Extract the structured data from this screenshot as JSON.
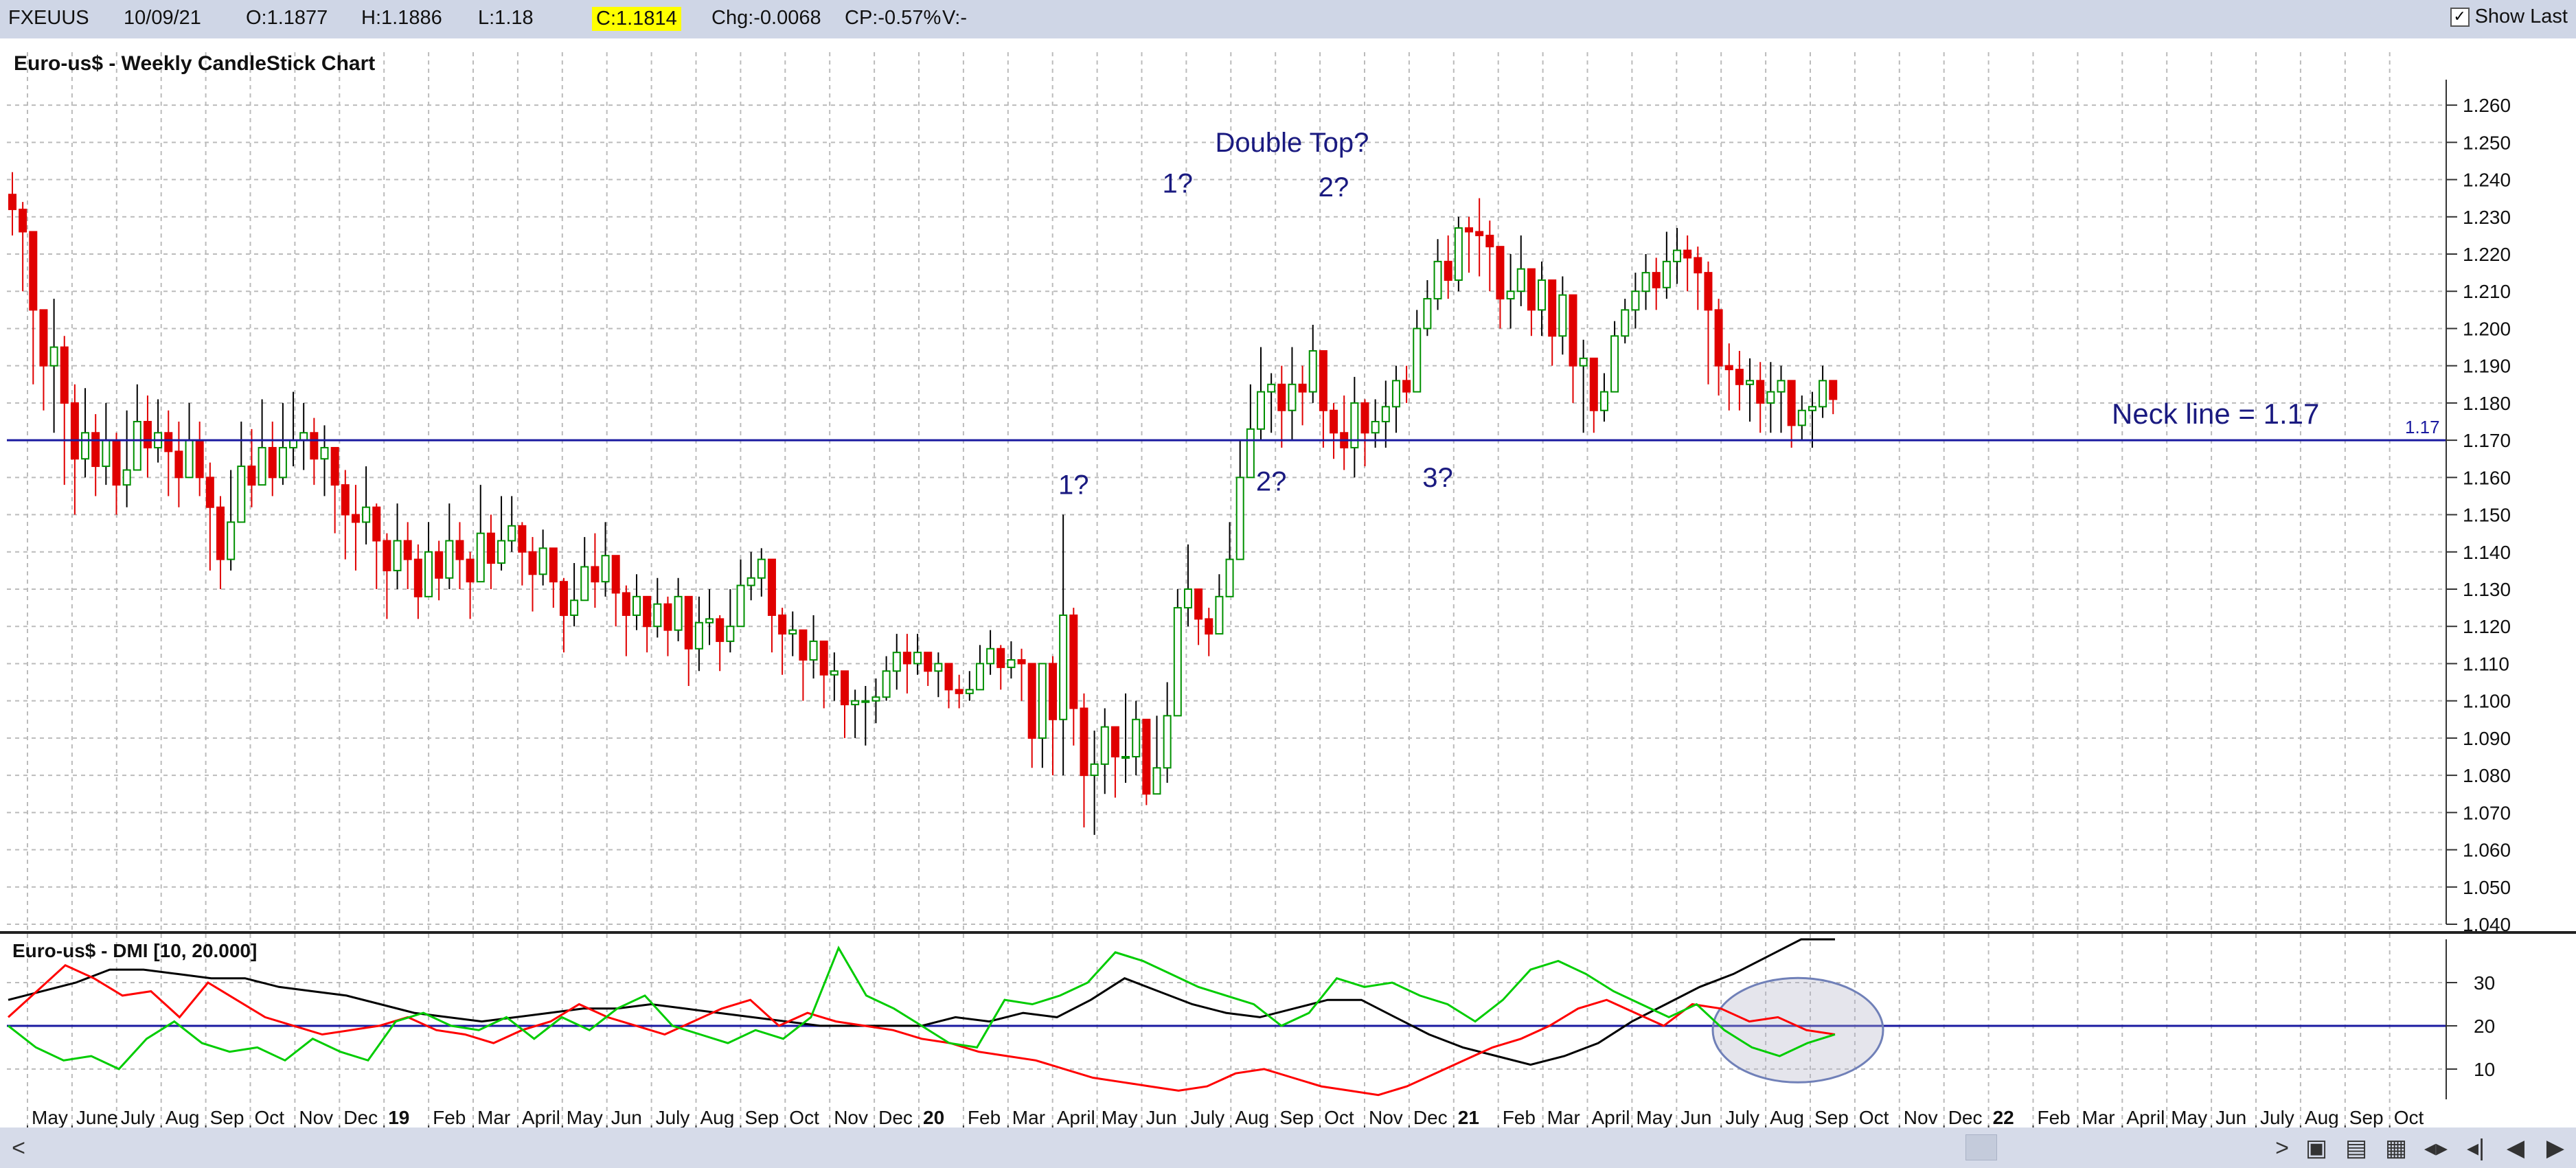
{
  "info": {
    "symbol": "FXEUUS",
    "date": "10/09/21",
    "open": "O:1.1877",
    "high": "H:1.1886",
    "low": "L:1.18",
    "close": "C:1.1814",
    "change": "Chg:-0.0068",
    "change_pct": "CP:-0.57%",
    "volume": "V:-",
    "show_last": "Show Last",
    "show_last_checked": "✓"
  },
  "chart_data": [
    {
      "type": "candlestick",
      "title": "Euro-us$ - Weekly CandleStick Chart",
      "ylim": [
        1.04,
        1.265
      ],
      "y_ticks": [
        "1.260",
        "1.250",
        "1.240",
        "1.230",
        "1.220",
        "1.210",
        "1.200",
        "1.190",
        "1.180",
        "1.170",
        "1.160",
        "1.150",
        "1.140",
        "1.130",
        "1.120",
        "1.110",
        "1.100",
        "1.090",
        "1.080",
        "1.070",
        "1.060",
        "1.050",
        "1.040"
      ],
      "x_labels": [
        "May",
        "June",
        "July",
        "Aug",
        "Sep",
        "Oct",
        "Nov",
        "Dec",
        "19",
        "Feb",
        "Mar",
        "April",
        "May",
        "Jun",
        "July",
        "Aug",
        "Sep",
        "Oct",
        "Nov",
        "Dec",
        "20",
        "Feb",
        "Mar",
        "April",
        "May",
        "Jun",
        "July",
        "Aug",
        "Sep",
        "Oct",
        "Nov",
        "Dec",
        "21",
        "Feb",
        "Mar",
        "April",
        "May",
        "Jun",
        "July",
        "Aug",
        "Sep",
        "Oct",
        "Nov",
        "Dec",
        "22",
        "Feb",
        "Mar",
        "April",
        "May",
        "Jun",
        "July",
        "Aug",
        "Sep",
        "Oct"
      ],
      "neckline": {
        "value": 1.17,
        "label": "1.17",
        "annotation": "Neck line = 1.17"
      },
      "annotations": [
        {
          "text": "Double Top?",
          "week": 123,
          "value": 1.2475
        },
        {
          "text": "1?",
          "week": 112,
          "value": 1.2365
        },
        {
          "text": "2?",
          "week": 127,
          "value": 1.2355
        },
        {
          "text": "1?",
          "week": 102,
          "value": 1.1555
        },
        {
          "text": "2?",
          "week": 121,
          "value": 1.1565
        },
        {
          "text": "3?",
          "week": 137,
          "value": 1.1575
        }
      ],
      "closes": [
        1.232,
        1.226,
        1.205,
        1.19,
        1.195,
        1.18,
        1.165,
        1.172,
        1.163,
        1.17,
        1.158,
        1.162,
        1.175,
        1.168,
        1.172,
        1.167,
        1.16,
        1.17,
        1.16,
        1.152,
        1.138,
        1.148,
        1.163,
        1.158,
        1.168,
        1.16,
        1.168,
        1.17,
        1.172,
        1.165,
        1.168,
        1.158,
        1.15,
        1.148,
        1.152,
        1.143,
        1.135,
        1.143,
        1.138,
        1.128,
        1.14,
        1.133,
        1.143,
        1.138,
        1.132,
        1.145,
        1.137,
        1.143,
        1.147,
        1.14,
        1.134,
        1.141,
        1.132,
        1.123,
        1.127,
        1.136,
        1.132,
        1.139,
        1.129,
        1.123,
        1.128,
        1.12,
        1.126,
        1.119,
        1.128,
        1.114,
        1.121,
        1.122,
        1.116,
        1.12,
        1.131,
        1.133,
        1.138,
        1.123,
        1.118,
        1.119,
        1.111,
        1.116,
        1.107,
        1.108,
        1.099,
        1.1,
        1.1,
        1.101,
        1.108,
        1.113,
        1.11,
        1.113,
        1.108,
        1.11,
        1.103,
        1.102,
        1.103,
        1.11,
        1.114,
        1.109,
        1.111,
        1.11,
        1.09,
        1.11,
        1.095,
        1.123,
        1.098,
        1.08,
        1.083,
        1.093,
        1.085,
        1.085,
        1.095,
        1.075,
        1.082,
        1.096,
        1.125,
        1.13,
        1.122,
        1.118,
        1.128,
        1.138,
        1.16,
        1.173,
        1.183,
        1.185,
        1.178,
        1.185,
        1.183,
        1.194,
        1.178,
        1.172,
        1.168,
        1.18,
        1.172,
        1.175,
        1.179,
        1.186,
        1.183,
        1.2,
        1.208,
        1.218,
        1.213,
        1.227,
        1.226,
        1.225,
        1.222,
        1.208,
        1.21,
        1.216,
        1.205,
        1.213,
        1.198,
        1.209,
        1.19,
        1.192,
        1.178,
        1.183,
        1.198,
        1.205,
        1.21,
        1.215,
        1.211,
        1.218,
        1.221,
        1.219,
        1.215,
        1.205,
        1.19,
        1.189,
        1.185,
        1.186,
        1.18,
        1.183,
        1.186,
        1.174,
        1.178,
        1.179,
        1.186,
        1.181
      ],
      "highs": [
        1.242,
        1.234,
        1.218,
        1.204,
        1.208,
        1.198,
        1.185,
        1.184,
        1.177,
        1.18,
        1.172,
        1.178,
        1.185,
        1.182,
        1.181,
        1.178,
        1.175,
        1.18,
        1.175,
        1.164,
        1.155,
        1.162,
        1.175,
        1.173,
        1.181,
        1.175,
        1.18,
        1.183,
        1.18,
        1.176,
        1.174,
        1.168,
        1.162,
        1.158,
        1.163,
        1.153,
        1.145,
        1.153,
        1.148,
        1.142,
        1.148,
        1.143,
        1.153,
        1.148,
        1.14,
        1.158,
        1.15,
        1.155,
        1.155,
        1.148,
        1.144,
        1.146,
        1.14,
        1.133,
        1.137,
        1.144,
        1.145,
        1.148,
        1.136,
        1.131,
        1.134,
        1.128,
        1.133,
        1.128,
        1.133,
        1.122,
        1.128,
        1.13,
        1.123,
        1.13,
        1.138,
        1.14,
        1.141,
        1.128,
        1.125,
        1.124,
        1.118,
        1.123,
        1.111,
        1.113,
        1.105,
        1.103,
        1.104,
        1.106,
        1.112,
        1.118,
        1.118,
        1.118,
        1.113,
        1.113,
        1.106,
        1.107,
        1.108,
        1.115,
        1.119,
        1.115,
        1.116,
        1.114,
        1.102,
        1.1,
        1.112,
        1.15,
        1.125,
        1.102,
        1.092,
        1.098,
        1.092,
        1.102,
        1.1,
        1.085,
        1.096,
        1.105,
        1.13,
        1.142,
        1.127,
        1.125,
        1.134,
        1.148,
        1.17,
        1.185,
        1.195,
        1.188,
        1.19,
        1.195,
        1.19,
        1.201,
        1.19,
        1.18,
        1.182,
        1.187,
        1.181,
        1.181,
        1.186,
        1.19,
        1.19,
        1.205,
        1.213,
        1.224,
        1.225,
        1.23,
        1.23,
        1.235,
        1.229,
        1.22,
        1.22,
        1.225,
        1.215,
        1.218,
        1.212,
        1.214,
        1.2,
        1.197,
        1.188,
        1.188,
        1.202,
        1.208,
        1.215,
        1.22,
        1.219,
        1.226,
        1.227,
        1.225,
        1.222,
        1.218,
        1.208,
        1.196,
        1.194,
        1.192,
        1.191,
        1.191,
        1.19,
        1.185,
        1.182,
        1.183,
        1.19,
        1.186
      ],
      "lows": [
        1.225,
        1.21,
        1.185,
        1.178,
        1.172,
        1.158,
        1.15,
        1.16,
        1.155,
        1.158,
        1.15,
        1.152,
        1.162,
        1.16,
        1.164,
        1.155,
        1.152,
        1.16,
        1.155,
        1.135,
        1.13,
        1.135,
        1.148,
        1.152,
        1.158,
        1.155,
        1.158,
        1.163,
        1.162,
        1.158,
        1.155,
        1.145,
        1.138,
        1.135,
        1.142,
        1.13,
        1.122,
        1.13,
        1.13,
        1.122,
        1.132,
        1.127,
        1.13,
        1.13,
        1.122,
        1.134,
        1.13,
        1.135,
        1.14,
        1.131,
        1.124,
        1.131,
        1.125,
        1.113,
        1.12,
        1.127,
        1.125,
        1.128,
        1.12,
        1.112,
        1.119,
        1.113,
        1.117,
        1.112,
        1.116,
        1.104,
        1.108,
        1.115,
        1.108,
        1.113,
        1.12,
        1.127,
        1.128,
        1.113,
        1.107,
        1.112,
        1.1,
        1.106,
        1.098,
        1.1,
        1.09,
        1.09,
        1.088,
        1.094,
        1.1,
        1.103,
        1.102,
        1.107,
        1.104,
        1.101,
        1.098,
        1.098,
        1.1,
        1.106,
        1.107,
        1.103,
        1.106,
        1.1,
        1.082,
        1.082,
        1.08,
        1.08,
        1.088,
        1.066,
        1.064,
        1.075,
        1.074,
        1.078,
        1.08,
        1.072,
        1.076,
        1.078,
        1.096,
        1.12,
        1.115,
        1.112,
        1.118,
        1.128,
        1.145,
        1.162,
        1.17,
        1.172,
        1.168,
        1.17,
        1.174,
        1.18,
        1.168,
        1.165,
        1.162,
        1.16,
        1.163,
        1.168,
        1.168,
        1.172,
        1.18,
        1.192,
        1.198,
        1.205,
        1.208,
        1.21,
        1.215,
        1.214,
        1.21,
        1.2,
        1.2,
        1.206,
        1.198,
        1.198,
        1.19,
        1.193,
        1.18,
        1.172,
        1.172,
        1.175,
        1.185,
        1.196,
        1.2,
        1.205,
        1.205,
        1.208,
        1.212,
        1.21,
        1.205,
        1.185,
        1.182,
        1.178,
        1.178,
        1.175,
        1.172,
        1.172,
        1.172,
        1.168,
        1.17,
        1.168,
        1.176,
        1.177
      ]
    },
    {
      "type": "line",
      "title": "Euro-us$ - DMI [10, 20.000]",
      "ylim": [
        3,
        40
      ],
      "y_ticks": [
        "30",
        "20",
        "10"
      ],
      "reference_line": 20,
      "series": [
        {
          "color": "#000000",
          "values": [
            26,
            28,
            30,
            33,
            33,
            32,
            31,
            31,
            29,
            28,
            27,
            25,
            23,
            22,
            21,
            22,
            23,
            24,
            24,
            25,
            24,
            23,
            22,
            21,
            20,
            20,
            20,
            20,
            22,
            21,
            23,
            22,
            26,
            31,
            28,
            25,
            23,
            22,
            24,
            26,
            26,
            22,
            18,
            15,
            13,
            11,
            13,
            16,
            21,
            25,
            29,
            32,
            36,
            40,
            44
          ]
        },
        {
          "color": "#ff0000",
          "values": [
            22,
            28,
            34,
            31,
            27,
            28,
            22,
            30,
            26,
            22,
            20,
            18,
            19,
            20,
            22,
            19,
            18,
            16,
            19,
            21,
            25,
            22,
            20,
            18,
            21,
            24,
            26,
            20,
            23,
            21,
            20,
            19,
            17,
            16,
            14,
            13,
            12,
            10,
            8,
            7,
            6,
            5,
            6,
            9,
            10,
            8,
            6,
            5,
            4,
            6,
            9,
            12,
            15,
            17,
            20,
            24,
            26,
            23,
            20,
            25,
            24,
            21,
            22,
            19,
            18
          ]
        },
        {
          "color": "#00cc00",
          "values": [
            20,
            15,
            12,
            13,
            10,
            17,
            21,
            16,
            14,
            15,
            12,
            17,
            14,
            12,
            21,
            23,
            20,
            19,
            22,
            17,
            22,
            19,
            24,
            27,
            20,
            18,
            16,
            19,
            17,
            22,
            38,
            27,
            24,
            20,
            16,
            15,
            26,
            25,
            27,
            30,
            37,
            35,
            32,
            29,
            27,
            25,
            20,
            23,
            31,
            29,
            30,
            27,
            25,
            21,
            26,
            33,
            35,
            32,
            28,
            25,
            22,
            25,
            19,
            15,
            13,
            16,
            18
          ]
        }
      ],
      "highlight": "ellipse"
    }
  ],
  "toolbar": {
    "left_arrow": "<",
    "right_arrow": ">"
  }
}
